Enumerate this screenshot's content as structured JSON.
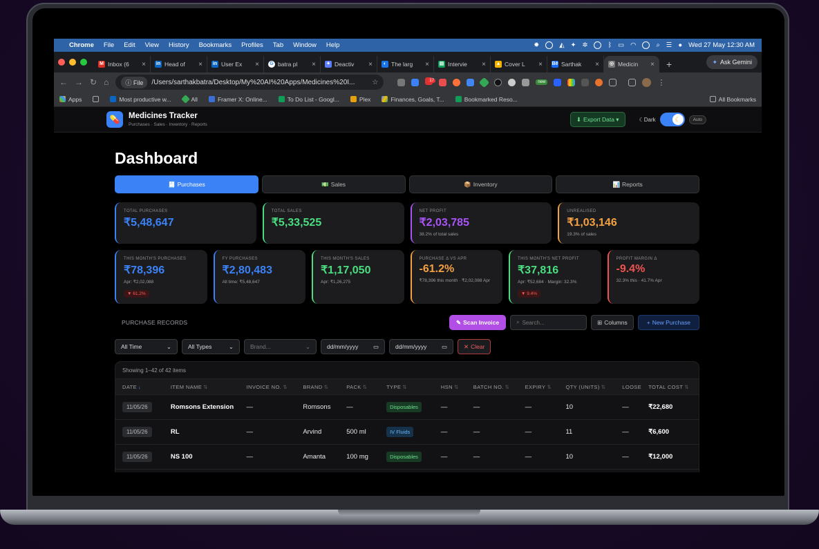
{
  "menubar": {
    "app": "Chrome",
    "items": [
      "File",
      "Edit",
      "View",
      "History",
      "Bookmarks",
      "Profiles",
      "Tab",
      "Window",
      "Help"
    ],
    "clock": "Wed 27 May  12:30 AM"
  },
  "browser": {
    "tabs": [
      {
        "label": "Inbox (6",
        "color": "#d93025",
        "glyph": "M"
      },
      {
        "label": "Head of",
        "color": "#0a66c2",
        "glyph": "in"
      },
      {
        "label": "User Ex",
        "color": "#0a66c2",
        "glyph": "in"
      },
      {
        "label": "batra pl",
        "color": "#ffffff",
        "glyph": "G"
      },
      {
        "label": "Deactiv",
        "color": "#5b7cff",
        "glyph": "✦"
      },
      {
        "label": "The larg",
        "color": "#1a73e8",
        "glyph": "◐"
      },
      {
        "label": "Intervie",
        "color": "#0f9d58",
        "glyph": "▤"
      },
      {
        "label": "Cover L",
        "color": "#f4b400",
        "glyph": "▲"
      },
      {
        "label": "Sarthak",
        "color": "#1769ff",
        "glyph": "Bē"
      },
      {
        "label": "Medicin",
        "color": "#777777",
        "glyph": "◎"
      }
    ],
    "ask_gemini": "Ask Gemini",
    "omni_chip": "File",
    "url": "/Users/sarthakbatra/Desktop/My%20AI%20Apps/Medicines%20I...",
    "ext_badge": "17",
    "ext_new": "new",
    "bookmarks": [
      "Apps",
      "Most productive w...",
      "All",
      "Framer X: Online...",
      "To Do List - Googl...",
      "Plex",
      "Finances, Goals, T...",
      "Bookmarked Reso..."
    ],
    "all_bookmarks": "All Bookmarks"
  },
  "app": {
    "title": "Medicines Tracker",
    "subtitle": "Purchases · Sales · Inventory · Reports",
    "export_label": "Export Data ▾",
    "dark_label": "Dark",
    "auto_label": "Auto",
    "page_title": "Dashboard",
    "tabs": [
      {
        "icon": "🧾",
        "label": "Purchases"
      },
      {
        "icon": "💵",
        "label": "Sales"
      },
      {
        "icon": "📦",
        "label": "Inventory"
      },
      {
        "icon": "📊",
        "label": "Reports"
      }
    ],
    "summary_cards": [
      {
        "label": "TOTAL PURCHASES",
        "value": "₹5,48,647",
        "sub": "",
        "color": "#3b82f6"
      },
      {
        "label": "TOTAL SALES",
        "value": "₹5,33,525",
        "sub": "",
        "color": "#4ade80"
      },
      {
        "label": "NET PROFIT",
        "value": "₹2,03,785",
        "sub": "38.2% of total sales",
        "color": "#a855f7"
      },
      {
        "label": "UNREALISED",
        "value": "₹1,03,146",
        "sub": "19.3% of sales",
        "color": "#f5a142"
      }
    ],
    "month_cards": [
      {
        "label": "THIS MONTH'S PURCHASES",
        "value": "₹78,396",
        "sub": "Apr: ₹2,02,088",
        "badge": "▼ 61.2%",
        "color": "#3b82f6"
      },
      {
        "label": "FY PURCHASES",
        "value": "₹2,80,483",
        "sub": "All time: ₹5,48,647",
        "badge": "",
        "color": "#3b82f6"
      },
      {
        "label": "THIS MONTH'S SALES",
        "value": "₹1,17,050",
        "sub": "Apr: ₹1,26,275",
        "badge": "",
        "color": "#4ade80"
      },
      {
        "label": "PURCHASE Δ VS APR",
        "value": "-61.2%",
        "sub": "₹78,396 this month · ₹2,02,088 Apr",
        "badge": "",
        "color": "#f5a142"
      },
      {
        "label": "THIS MONTH'S NET PROFIT",
        "value": "₹37,816",
        "sub": "Apr: ₹52,684 · Margin: 32.3%",
        "badge": "▼ 9.4%",
        "color": "#4ade80"
      },
      {
        "label": "PROFIT MARGIN Δ",
        "value": "-9.4%",
        "sub": "32.3% this · 41.7% Apr",
        "badge": "",
        "color": "#ef5350"
      }
    ],
    "records": {
      "title": "PURCHASE RECORDS",
      "scan_label": "Scan Invoice",
      "search_placeholder": "Search...",
      "columns_label": "Columns",
      "new_label": "New Purchase",
      "filters": {
        "time": "All Time",
        "types": "All Types",
        "brand_placeholder": "Brand...",
        "date_from": "dd/mm/yyyy",
        "date_to": "dd/mm/yyyy",
        "clear": "Clear"
      },
      "showing": "Showing 1–42 of 42 items",
      "columns": [
        "DATE",
        "ITEM NAME",
        "INVOICE NO.",
        "BRAND",
        "PACK",
        "TYPE",
        "HSN",
        "BATCH NO.",
        "EXPIRY",
        "QTY (UNITS)",
        "LOOSE",
        "TOTAL COST"
      ],
      "rows": [
        {
          "date": "11/05/26",
          "item": "Romsons Extension",
          "invoice": "—",
          "brand": "Romsons",
          "pack": "—",
          "type": "Disposables",
          "hsn": "—",
          "batch": "—",
          "expiry": "—",
          "qty": "10",
          "loose": "—",
          "total": "₹22,680"
        },
        {
          "date": "11/05/26",
          "item": "RL",
          "invoice": "—",
          "brand": "Arvind",
          "pack": "500 ml",
          "type": "IV Fluids",
          "hsn": "—",
          "batch": "—",
          "expiry": "—",
          "qty": "11",
          "loose": "—",
          "total": "₹6,600"
        },
        {
          "date": "11/05/26",
          "item": "NS 100",
          "invoice": "—",
          "brand": "Amanta",
          "pack": "100 mg",
          "type": "Disposables",
          "hsn": "—",
          "batch": "—",
          "expiry": "—",
          "qty": "10",
          "loose": "—",
          "total": "₹12,000"
        }
      ]
    }
  }
}
